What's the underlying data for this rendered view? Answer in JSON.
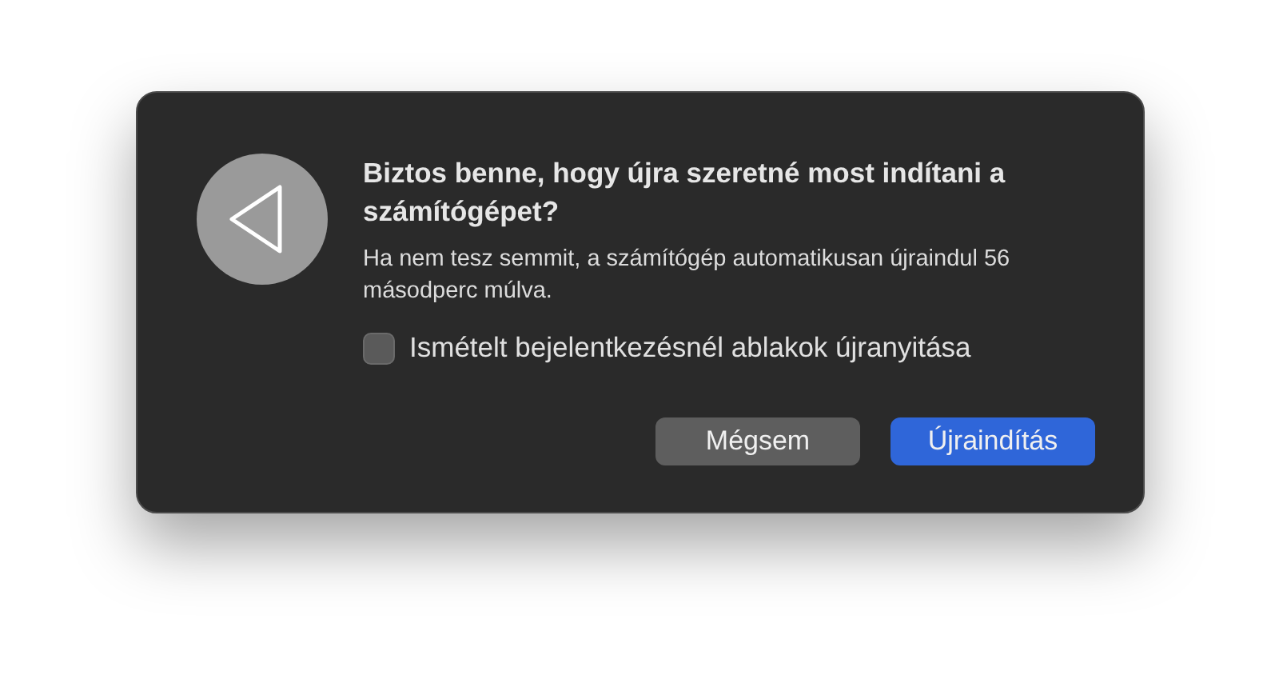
{
  "dialog": {
    "title": "Biztos benne, hogy újra szeretné most indítani a számítógépet?",
    "message": "Ha nem tesz semmit, a számítógép automatikusan újraindul 56 másodperc múlva.",
    "checkbox": {
      "label": "Ismételt bejelentkezésnél ablakok újranyitása",
      "checked": false
    },
    "buttons": [
      {
        "label": "Mégsem",
        "kind": "cancel"
      },
      {
        "label": "Újraindítás",
        "kind": "default"
      }
    ]
  }
}
